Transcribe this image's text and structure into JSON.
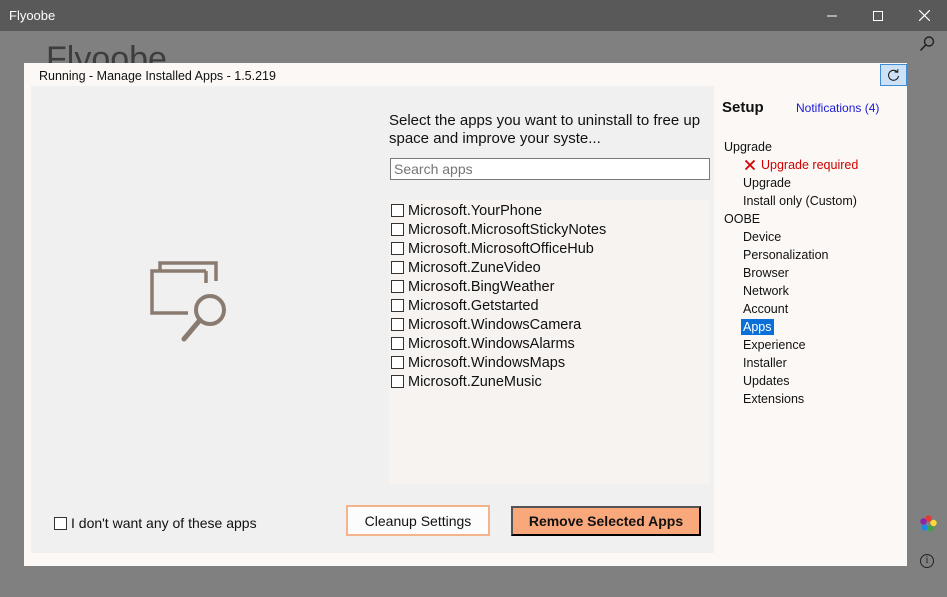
{
  "window": {
    "title": "Flyoobe",
    "background_title": "Flyoobe"
  },
  "dialog": {
    "title": "Running - Manage Installed Apps - 1.5.219"
  },
  "main": {
    "description": "Select the apps you want to uninstall to free up space and improve your syste...",
    "search_placeholder": "Search apps",
    "apps": [
      {
        "label": "Microsoft.YourPhone",
        "checked": false
      },
      {
        "label": "Microsoft.MicrosoftStickyNotes",
        "checked": false
      },
      {
        "label": "Microsoft.MicrosoftOfficeHub",
        "checked": false
      },
      {
        "label": "Microsoft.ZuneVideo",
        "checked": false
      },
      {
        "label": "Microsoft.BingWeather",
        "checked": false
      },
      {
        "label": "Microsoft.Getstarted",
        "checked": false
      },
      {
        "label": "Microsoft.WindowsCamera",
        "checked": false
      },
      {
        "label": "Microsoft.WindowsAlarms",
        "checked": false
      },
      {
        "label": "Microsoft.WindowsMaps",
        "checked": false
      },
      {
        "label": "Microsoft.ZuneMusic",
        "checked": false
      }
    ],
    "optout_label": "I don't want any of these apps",
    "cleanup_label": "Cleanup Settings",
    "remove_label": "Remove Selected Apps"
  },
  "sidebar": {
    "title": "Setup",
    "notifications": "Notifications (4)",
    "items": [
      {
        "label": "Upgrade",
        "kind": "section"
      },
      {
        "label": "Upgrade required",
        "kind": "warn"
      },
      {
        "label": "Upgrade",
        "kind": "sub"
      },
      {
        "label": "Install only (Custom)",
        "kind": "sub"
      },
      {
        "label": "OOBE",
        "kind": "section"
      },
      {
        "label": "Device",
        "kind": "sub"
      },
      {
        "label": "Personalization",
        "kind": "sub"
      },
      {
        "label": "Browser",
        "kind": "sub"
      },
      {
        "label": "Network",
        "kind": "sub"
      },
      {
        "label": "Account",
        "kind": "sub"
      },
      {
        "label": "Apps",
        "kind": "sub",
        "selected": true
      },
      {
        "label": "Experience",
        "kind": "sub"
      },
      {
        "label": "Installer",
        "kind": "sub"
      },
      {
        "label": "Updates",
        "kind": "sub"
      },
      {
        "label": "Extensions",
        "kind": "sub"
      }
    ]
  },
  "icons": {
    "minimize": "minimize-icon",
    "maximize": "maximize-icon",
    "close": "close-icon",
    "search": "search-icon",
    "refresh": "refresh-icon",
    "illustration": "app-windows-search-icon",
    "error": "error-x-icon",
    "colors": "color-palette-icon",
    "info": "info-icon"
  },
  "colors": {
    "accent": "#0a6fd6",
    "primary_button": "#f9a87b",
    "secondary_border": "#f3b38d",
    "error": "#d20000",
    "illustration": "#8a7b70"
  }
}
